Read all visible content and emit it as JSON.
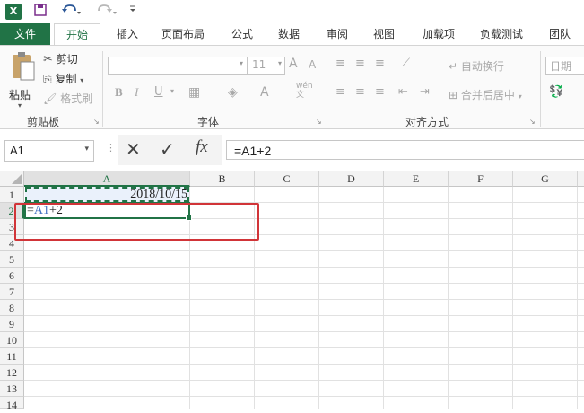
{
  "qat": {
    "logo": "X"
  },
  "tabs": [
    "文件",
    "开始",
    "插入",
    "页面布局",
    "公式",
    "数据",
    "审阅",
    "视图",
    "加载项",
    "负载测试",
    "团队"
  ],
  "clipboard": {
    "paste": "粘贴",
    "cut": "剪切",
    "copy": "复制",
    "format_painter": "格式刷",
    "group_label": "剪贴板"
  },
  "font": {
    "size": "11",
    "bold": "B",
    "italic": "I",
    "underline": "U",
    "group_label": "字体",
    "grow": "A",
    "shrink": "A",
    "font_color": "A",
    "phonetic_top": "wén",
    "phonetic_bottom": "文"
  },
  "alignment": {
    "wrap_text": "自动换行",
    "merge_center": "合并后居中",
    "group_label": "对齐方式"
  },
  "number": {
    "format": "日期"
  },
  "formula_bar": {
    "name_box": "A1",
    "fx": "fx",
    "formula": "=A1+2"
  },
  "grid": {
    "columns": [
      "A",
      "B",
      "C",
      "D",
      "E",
      "F",
      "G"
    ],
    "rows": [
      "1",
      "2",
      "3",
      "4",
      "5",
      "6",
      "7",
      "8",
      "9",
      "10",
      "11",
      "12",
      "13",
      "14"
    ],
    "a1_value": "2018/10/15",
    "a2_edit_eq": "=",
    "a2_edit_ref": "A1",
    "a2_edit_rest": "+2"
  },
  "colors": {
    "accent": "#217346",
    "ref_blue": "#4472c4",
    "annotation_red": "#d13438"
  }
}
